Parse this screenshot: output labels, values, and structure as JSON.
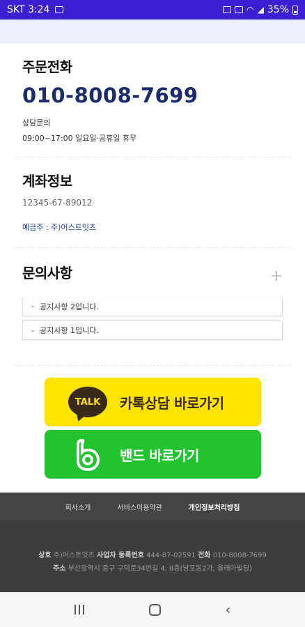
{
  "statusbar": {
    "carrier_time": "SKT 3:24",
    "battery": "35%"
  },
  "order_phone": {
    "title": "주문전화",
    "number": "010-8008-7699",
    "inquiry_label": "상담문의",
    "hours": "09:00~17:00 일요일·공휴일 휴무"
  },
  "account": {
    "title": "계좌정보",
    "number": "12345-67-89012",
    "holder": "예금주 : 주)어스트잇츠"
  },
  "inquiry": {
    "title": "문의사항",
    "expand": "+",
    "notices": [
      "공지사항 2입니다.",
      "공지사항 1입니다."
    ],
    "dash": "-"
  },
  "buttons": {
    "kakao_badge": "TALK",
    "kakao": "카톡상담 바로가기",
    "band": "밴드 바로가기"
  },
  "footer": {
    "links": [
      "회사소개",
      "서비스이용약관",
      "개인정보처리방침"
    ],
    "company_label": "상호",
    "company": "주)어스트잇츠",
    "biz_label": "사업자 등록번호",
    "biz_number": "444-87-02591",
    "phone_label": "전화",
    "phone": "010-8008-7699",
    "address_label": "주소",
    "address": "부산광역시 중구 구덕로34번길 4, 8층(남포동2가, 올래아빌딩)"
  },
  "colors": {
    "statusbar": "#3b1fd1",
    "kakao": "#fce300",
    "band": "#21c32f",
    "phone": "#1b2b6e"
  }
}
